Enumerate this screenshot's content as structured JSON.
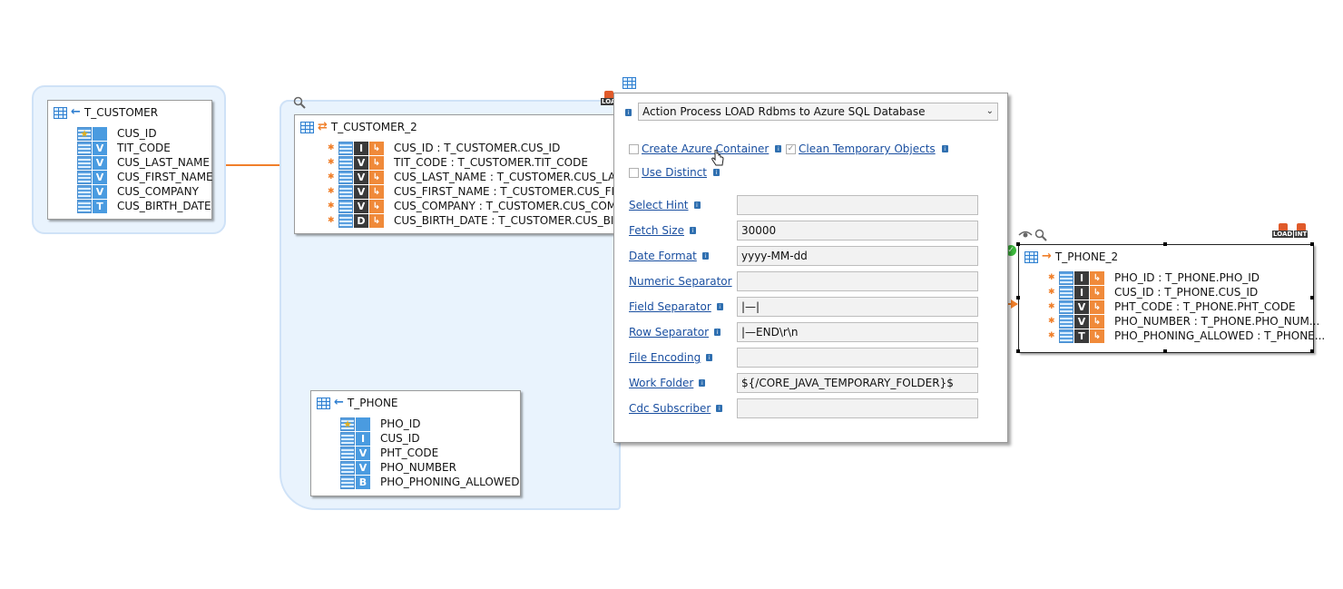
{
  "t_customer": {
    "title": "T_CUSTOMER",
    "rows": [
      {
        "label": "CUS_ID",
        "icon": "key"
      },
      {
        "label": "TIT_CODE",
        "icon": "V"
      },
      {
        "label": "CUS_LAST_NAME",
        "icon": "V"
      },
      {
        "label": "CUS_FIRST_NAME",
        "icon": "V"
      },
      {
        "label": "CUS_COMPANY",
        "icon": "V"
      },
      {
        "label": "CUS_BIRTH_DATE",
        "icon": "T"
      }
    ]
  },
  "t_customer_2": {
    "title": "T_CUSTOMER_2",
    "rows": [
      {
        "label": "CUS_ID : T_CUSTOMER.CUS_ID",
        "icon": "I"
      },
      {
        "label": "TIT_CODE : T_CUSTOMER.TIT_CODE",
        "icon": "V"
      },
      {
        "label": "CUS_LAST_NAME : T_CUSTOMER.CUS_LAST_NAM",
        "icon": "V"
      },
      {
        "label": "CUS_FIRST_NAME : T_CUSTOMER.CUS_FIRST_NAM",
        "icon": "V"
      },
      {
        "label": "CUS_COMPANY : T_CUSTOMER.CUS_COMPANY",
        "icon": "V"
      },
      {
        "label": "CUS_BIRTH_DATE : T_CUSTOMER.CUS_BIRTH_DAT",
        "icon": "D"
      }
    ]
  },
  "t_phone": {
    "title": "T_PHONE",
    "rows": [
      {
        "label": "PHO_ID",
        "icon": "key"
      },
      {
        "label": "CUS_ID",
        "icon": "I"
      },
      {
        "label": "PHT_CODE",
        "icon": "V"
      },
      {
        "label": "PHO_NUMBER",
        "icon": "V"
      },
      {
        "label": "PHO_PHONING_ALLOWED",
        "icon": "B"
      }
    ]
  },
  "t_phone_2": {
    "title": "T_PHONE_2",
    "rows": [
      {
        "label": "PHO_ID : T_PHONE.PHO_ID",
        "icon": "I"
      },
      {
        "label": "CUS_ID : T_PHONE.CUS_ID",
        "icon": "I"
      },
      {
        "label": "PHT_CODE : T_PHONE.PHT_CODE",
        "icon": "V"
      },
      {
        "label": "PHO_NUMBER : T_PHONE.PHO_NUM...",
        "icon": "V"
      },
      {
        "label": "PHO_PHONING_ALLOWED : T_PHONE...",
        "icon": "T"
      }
    ]
  },
  "badges": {
    "load": "LOAD",
    "int": "INT",
    "load_short": "LOA"
  },
  "panel": {
    "process_select": "Action Process LOAD Rdbms to Azure SQL Database",
    "create_azure_container": {
      "label": "Create Azure Container",
      "checked": false
    },
    "clean_temporary_objects": {
      "label": "Clean Temporary Objects",
      "checked": true
    },
    "use_distinct": {
      "label": "Use Distinct",
      "checked": false
    },
    "fields": [
      {
        "label": "Select Hint",
        "value": ""
      },
      {
        "label": "Fetch Size",
        "value": "30000"
      },
      {
        "label": "Date Format",
        "value": "yyyy-MM-dd"
      },
      {
        "label": "Numeric Separator",
        "value": ""
      },
      {
        "label": "Field Separator",
        "value": "|—|"
      },
      {
        "label": "Row Separator",
        "value": "|—END\\r\\n"
      },
      {
        "label": "File Encoding",
        "value": ""
      },
      {
        "label": "Work Folder",
        "value": "${/CORE_JAVA_TEMPORARY_FOLDER}$"
      },
      {
        "label": "Cdc Subscriber",
        "value": ""
      }
    ]
  },
  "colors": {
    "group_bg": "#e9f3fd",
    "link": "#1a4fa0",
    "mapping_arrow": "#f07f2a",
    "connector": "#5aaae8"
  }
}
